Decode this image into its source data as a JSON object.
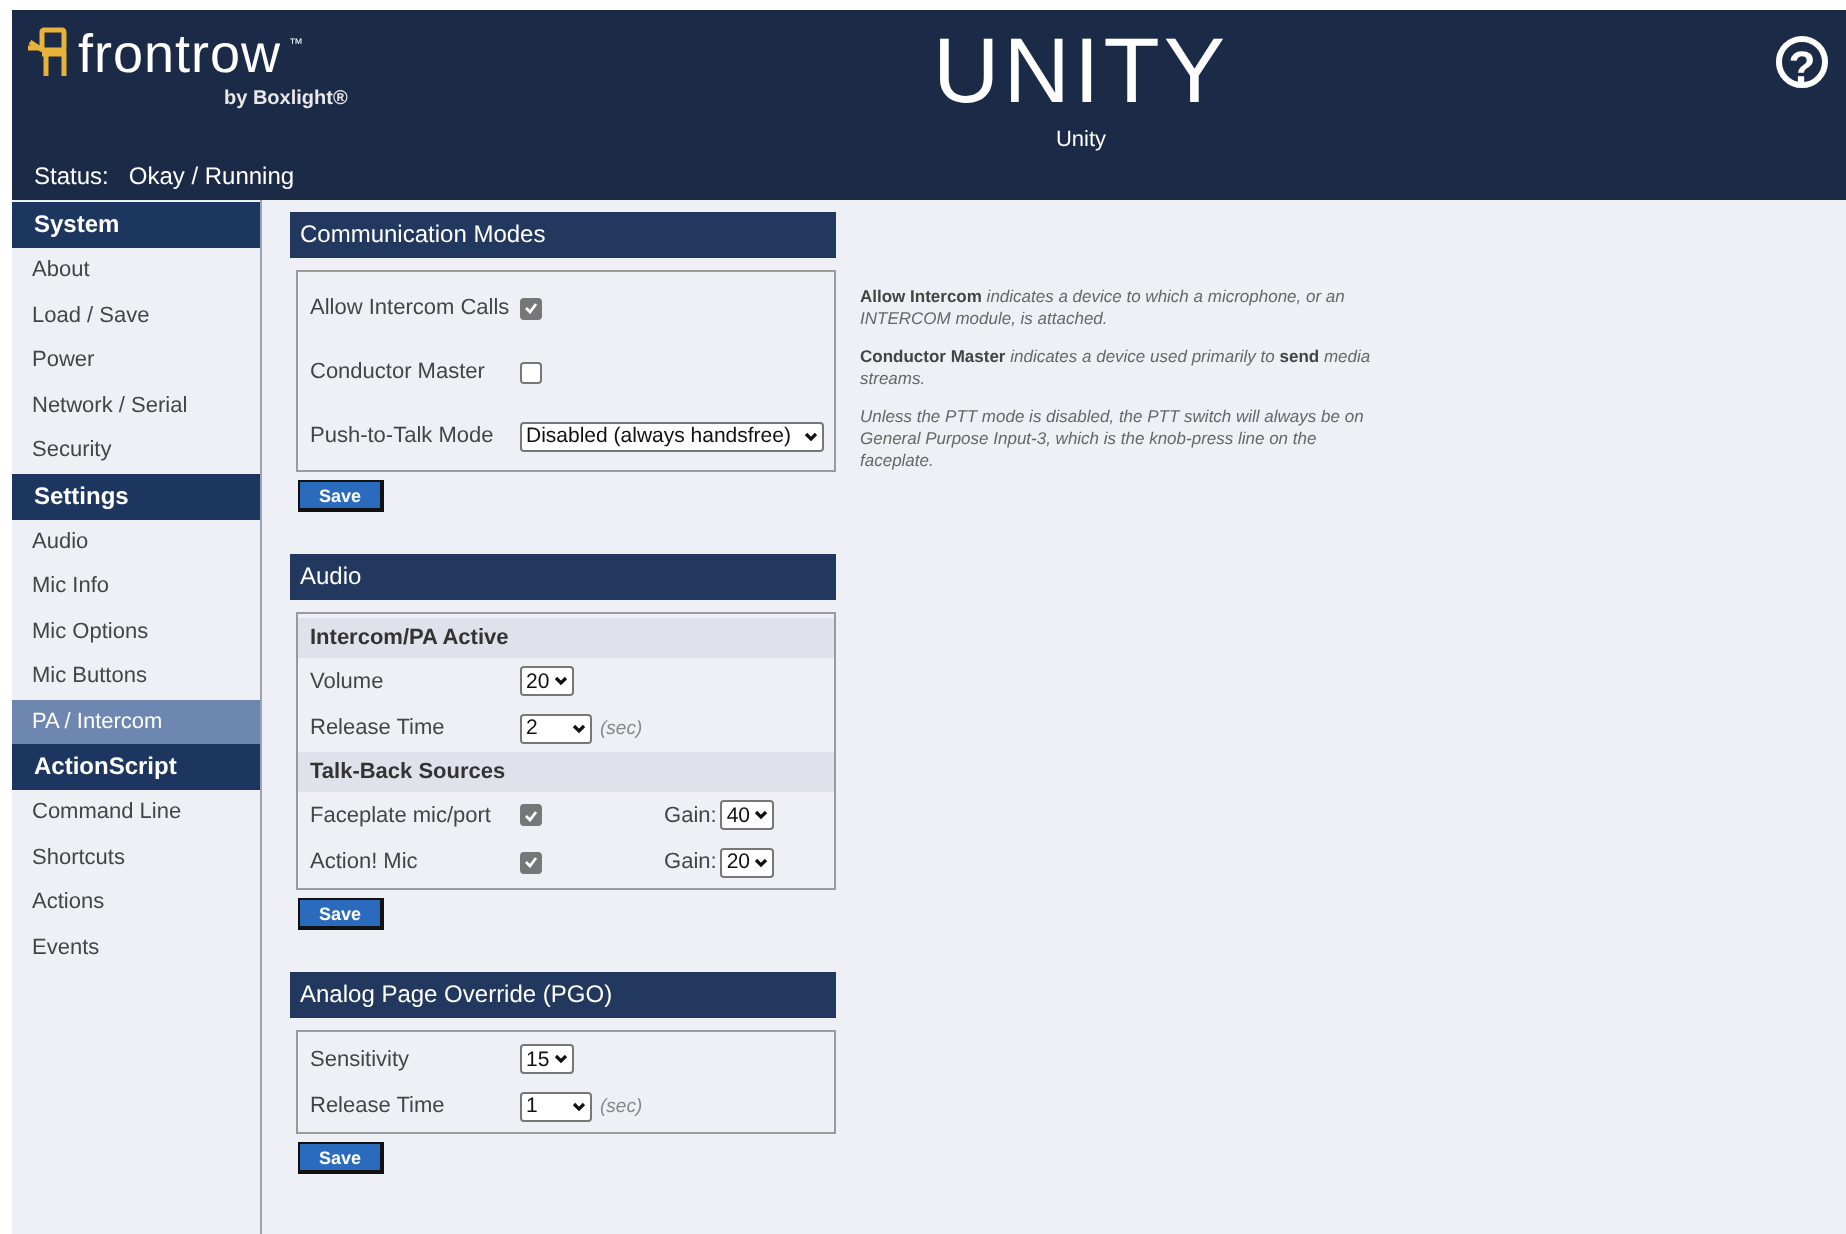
{
  "header": {
    "logo": "frontrow",
    "trademark": "™",
    "byline": "by Boxlight®",
    "title": "UNITY",
    "subtitle": "Unity",
    "help": "?",
    "status_label": "Status:",
    "status_value": "Okay / Running"
  },
  "sidebar": {
    "sections": [
      {
        "title": "System",
        "items": [
          {
            "label": "About",
            "selected": false
          },
          {
            "label": "Load / Save",
            "selected": false
          },
          {
            "label": "Power",
            "selected": false
          },
          {
            "label": "Network / Serial",
            "selected": false
          },
          {
            "label": "Security",
            "selected": false
          }
        ]
      },
      {
        "title": "Settings",
        "items": [
          {
            "label": "Audio",
            "selected": false
          },
          {
            "label": "Mic Info",
            "selected": false
          },
          {
            "label": "Mic Options",
            "selected": false
          },
          {
            "label": "Mic Buttons",
            "selected": false
          },
          {
            "label": "PA / Intercom",
            "selected": true
          }
        ]
      },
      {
        "title": "ActionScript",
        "items": [
          {
            "label": "Command Line",
            "selected": false
          },
          {
            "label": "Shortcuts",
            "selected": false
          },
          {
            "label": "Actions",
            "selected": false
          },
          {
            "label": "Events",
            "selected": false
          }
        ]
      }
    ]
  },
  "panels": [
    {
      "title": "Communication Modes",
      "rows": [
        {
          "kind": "checkbox",
          "label": "Allow Intercom Calls",
          "checked": true
        },
        {
          "kind": "checkbox",
          "label": "Conductor Master",
          "checked": false
        },
        {
          "kind": "select",
          "label": "Push-to-Talk Mode",
          "value": "Disabled (always handsfree)"
        }
      ],
      "save": "Save",
      "notes": [
        "**Allow Intercom** indicates a device to which a microphone, or an INTERCOM module, is attached.",
        "**Conductor Master** indicates a device used primarily to **send** media streams.",
        "Unless the PTT mode is disabled, the PTT switch will always be on General Purpose Input-3, which is the knob-press line on the faceplate."
      ]
    },
    {
      "title": "Audio",
      "rows": [
        {
          "kind": "subheading",
          "label": "Intercom/PA Active"
        },
        {
          "kind": "select",
          "label": "Volume",
          "value": "20"
        },
        {
          "kind": "select",
          "label": "Release Time",
          "value": "2",
          "unit": "(sec)"
        },
        {
          "kind": "subheading",
          "label": "Talk-Back Sources"
        },
        {
          "kind": "checkbox",
          "label": "Faceplate mic/port",
          "checked": true,
          "gain_label": "Gain:",
          "gain": "40"
        },
        {
          "kind": "checkbox",
          "label": "Action! Mic",
          "checked": true,
          "gain_label": "Gain:",
          "gain": "20"
        }
      ],
      "save": "Save"
    },
    {
      "title": "Analog Page Override (PGO)",
      "rows": [
        {
          "kind": "select",
          "label": "Sensitivity",
          "value": "15"
        },
        {
          "kind": "select",
          "label": "Release Time",
          "value": "1",
          "unit": "(sec)"
        }
      ],
      "save": "Save"
    }
  ]
}
